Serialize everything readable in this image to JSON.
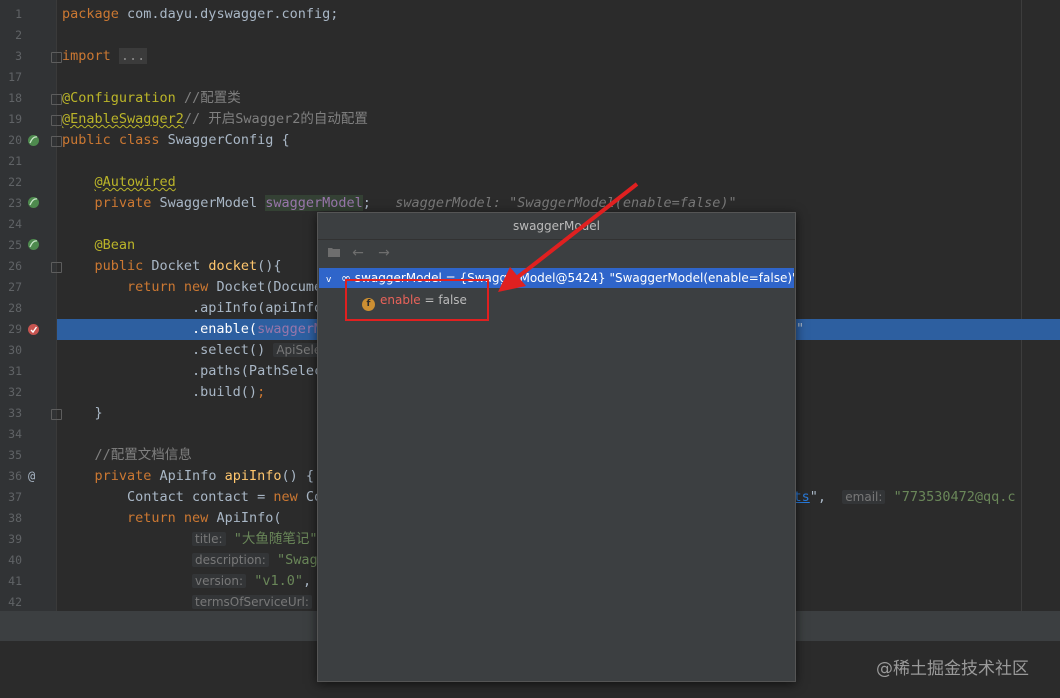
{
  "code_lines": [
    {
      "n": "1",
      "html": "<span class=\"kw\">package</span> com.dayu.dyswagger.config;"
    },
    {
      "n": "2",
      "html": ""
    },
    {
      "n": "3",
      "html": "<span class=\"kw\">import</span> <span class=\"fold-box\">...</span>"
    },
    {
      "n": "17",
      "html": ""
    },
    {
      "n": "18",
      "html": "<span class=\"ann\">@Configuration</span> <span class=\"cm\">//配置类</span>"
    },
    {
      "n": "19",
      "html": "<span class=\"ann-u\">@EnableSwagger2</span><span class=\"cm\">// 开启Swagger2的自动配置</span>"
    },
    {
      "n": "20",
      "html": "<span class=\"kw\">public class</span> SwaggerConfig {"
    },
    {
      "n": "21",
      "html": ""
    },
    {
      "n": "22",
      "html": "    <span class=\"ann-u\">@Autowired</span>"
    },
    {
      "n": "23",
      "html": "    <span class=\"kw\">private</span> SwaggerModel <span class=\"fld var-bg\">swaggerModel</span>;   <span class=\"inl\">swaggerModel: \"SwaggerModel(enable=false)\"</span>"
    },
    {
      "n": "24",
      "html": ""
    },
    {
      "n": "25",
      "html": "    <span class=\"ann\">@Bean</span>"
    },
    {
      "n": "26",
      "html": "    <span class=\"kw\">public</span> Docket <span class=\"fn\">docket</span>(){"
    },
    {
      "n": "27",
      "html": "        <span class=\"kw\">return new</span> Docket(Docume"
    },
    {
      "n": "28",
      "html": "                .apiInfo(apiInfo"
    },
    {
      "n": "29",
      "html": "                .enable(<span class=\"fld\">swaggerM</span>"
    },
    {
      "n": "30",
      "html": "                .select() <span class=\"hint\">ApiSelec</span>"
    },
    {
      "n": "31",
      "html": "                .paths(PathSelec"
    },
    {
      "n": "32",
      "html": "                .build()<span class=\"kw\">;</span>"
    },
    {
      "n": "33",
      "html": "    }"
    },
    {
      "n": "34",
      "html": ""
    },
    {
      "n": "35",
      "html": "    <span class=\"cm\">//配置文档信息</span>"
    },
    {
      "n": "36",
      "html": "    <span class=\"kw\">private</span> ApiInfo <span class=\"fn\">apiInfo</span>() {"
    },
    {
      "n": "37",
      "html": "        Contact contact = <span class=\"kw\">new</span> Co                                                  <span class=\"link\">7864/posts</span>\",  <span class=\"hint\">email:</span> <span class=\"str\">\"773530472@qq.c</span>"
    },
    {
      "n": "38",
      "html": "        <span class=\"kw\">return new</span> ApiInfo("
    },
    {
      "n": "39",
      "html": "                <span class=\"hint\">title:</span> <span class=\"str\">\"大鱼随笔记\",</span>"
    },
    {
      "n": "40",
      "html": "                <span class=\"hint\">description:</span> <span class=\"str\">\"Swagg</span>"
    },
    {
      "n": "41",
      "html": "                <span class=\"hint\">version:</span> <span class=\"str\">\"v1.0\"</span>, /"
    },
    {
      "n": "42",
      "html": "                <span class=\"hint\">termsOfServiceUrl:</span> <span class=\"str\">\"</span>"
    }
  ],
  "popup": {
    "title": "swaggerModel",
    "root_node": "∞ swaggerModel = {SwaggerModel@5424} \"SwaggerModel(enable=false)\"",
    "child_name": "enable",
    "child_value": " = false",
    "field_badge": "f"
  },
  "line29_tail": "\"",
  "watermark": "@稀土掘金技术社区",
  "colors": {
    "selection": "#2d5fa0",
    "tree_selection": "#2f65ca",
    "annotation_box": "#e02020",
    "arrow": "#e02020"
  }
}
